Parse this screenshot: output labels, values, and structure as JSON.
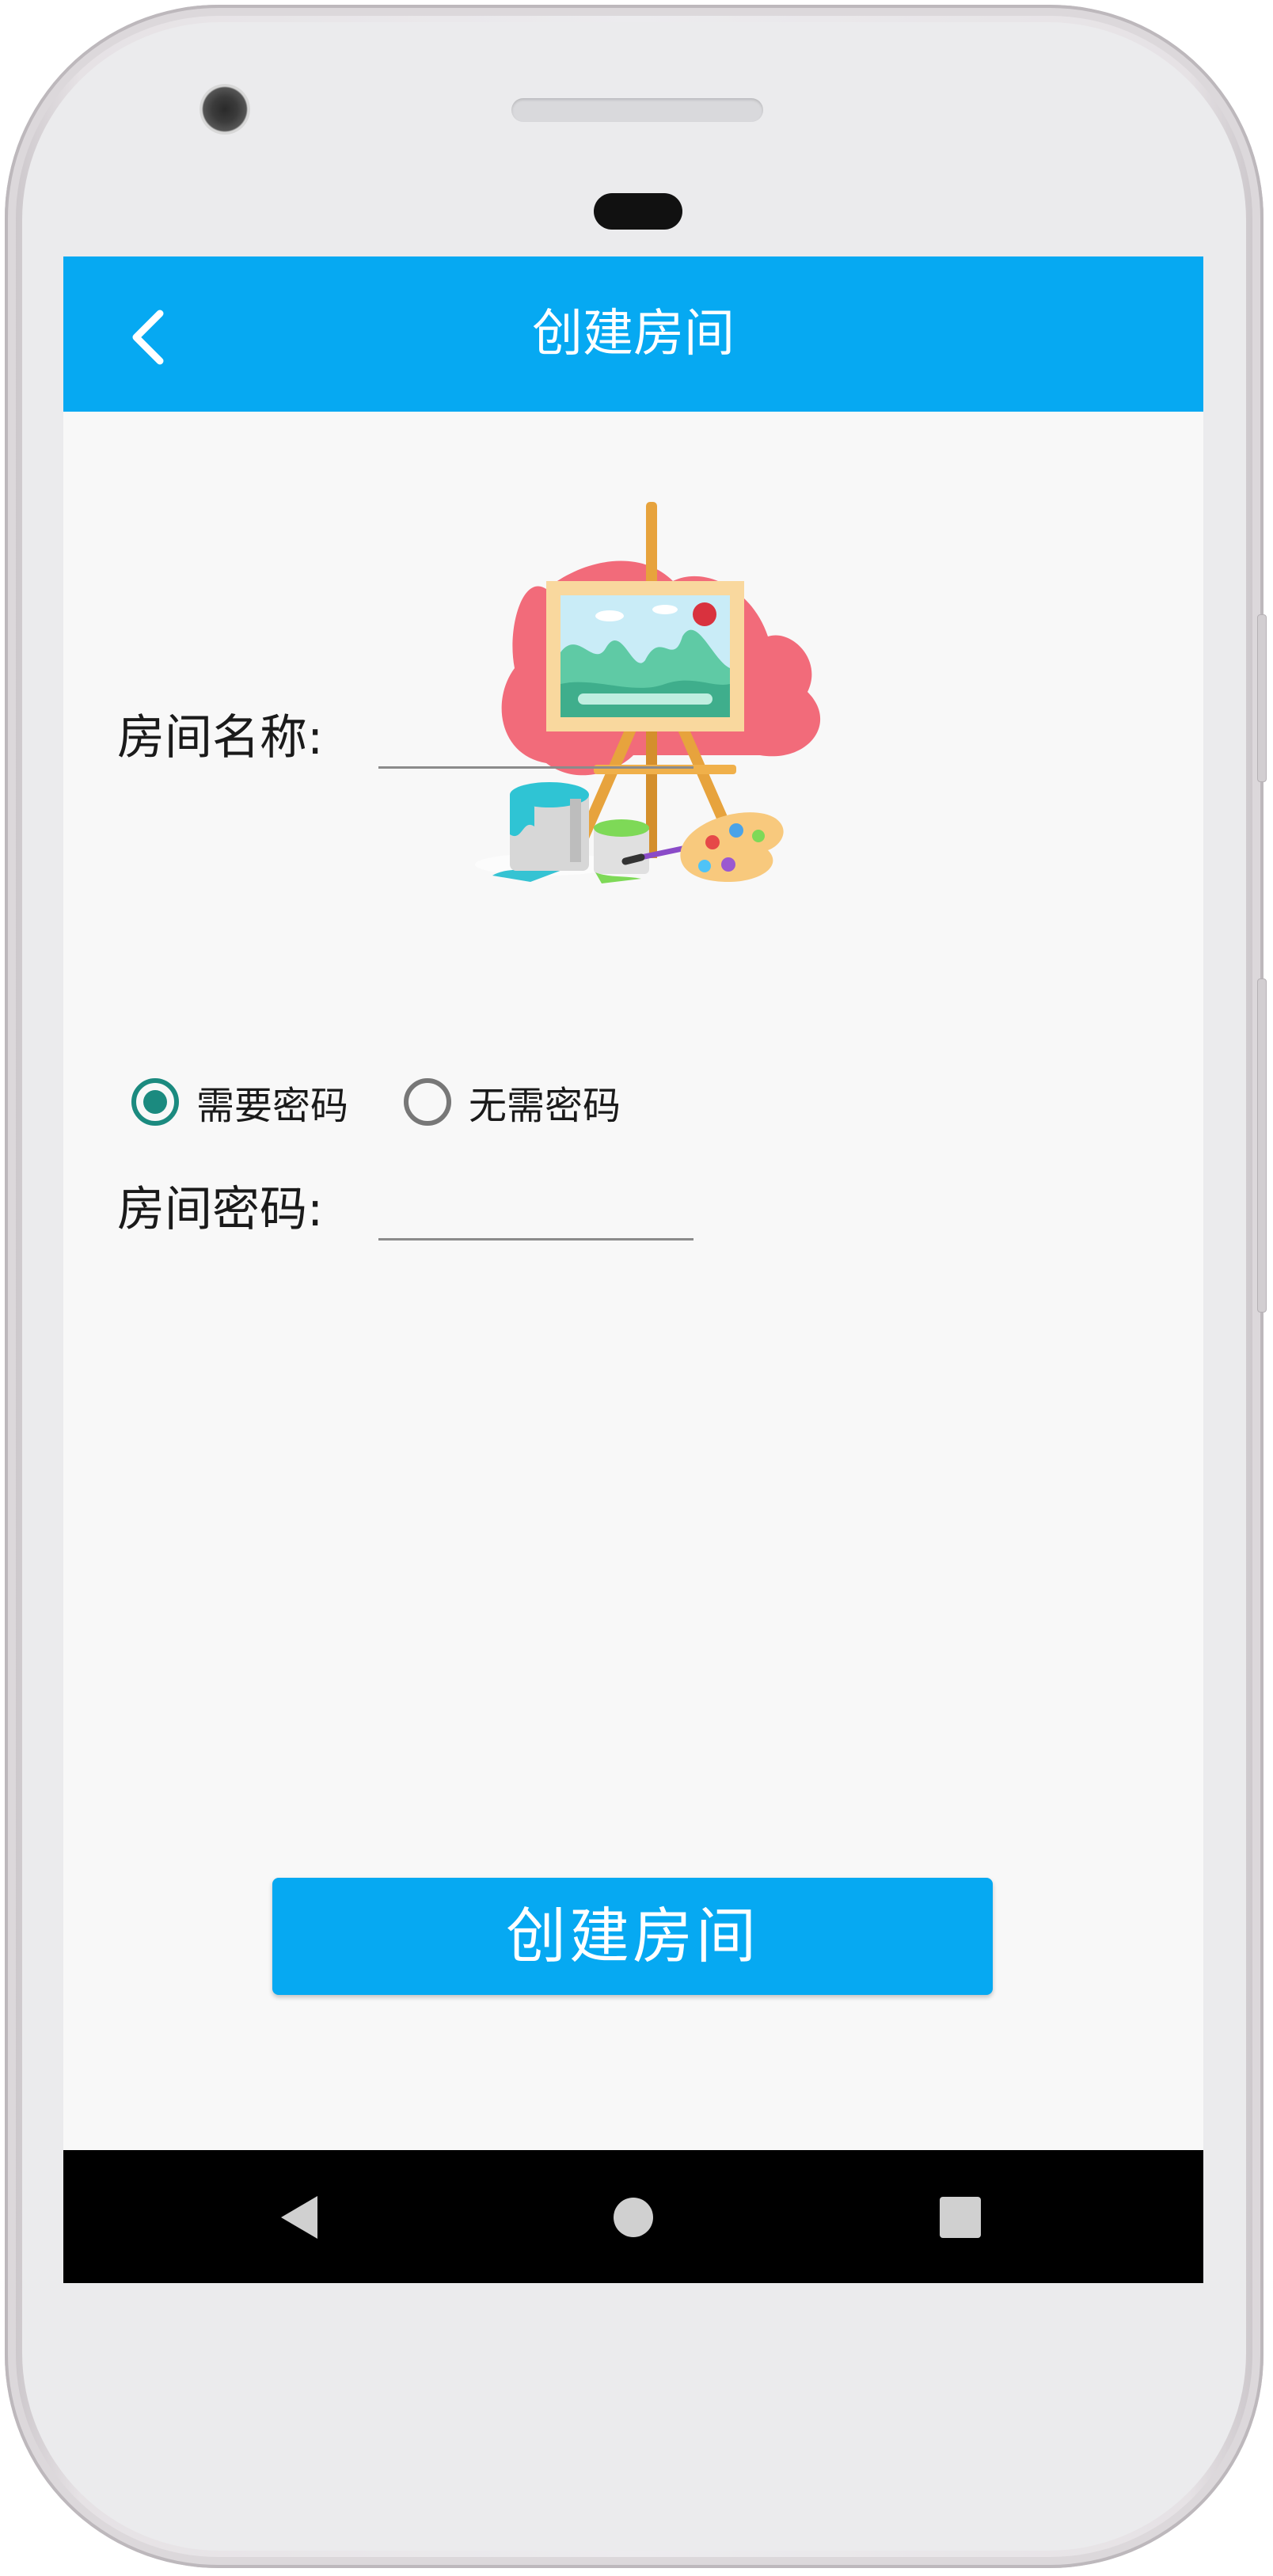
{
  "appbar": {
    "title": "创建房间",
    "back_icon": "chevron-left-icon"
  },
  "illustration": {
    "icon": "easel-painting-icon"
  },
  "form": {
    "room_name_label": "房间名称:",
    "room_name_value": "",
    "password_option_required": "需要密码",
    "password_option_none": "无需密码",
    "password_required_selected": true,
    "room_password_label": "房间密码:",
    "room_password_value": ""
  },
  "actions": {
    "create_button_label": "创建房间"
  },
  "navbar": {
    "back_icon": "triangle-back-icon",
    "home_icon": "circle-home-icon",
    "recents_icon": "square-recents-icon"
  },
  "colors": {
    "primary": "#06a9f2",
    "radio_checked": "#1b8a7f",
    "screen_background": "#f8f8f8",
    "navbar": "#000000"
  }
}
